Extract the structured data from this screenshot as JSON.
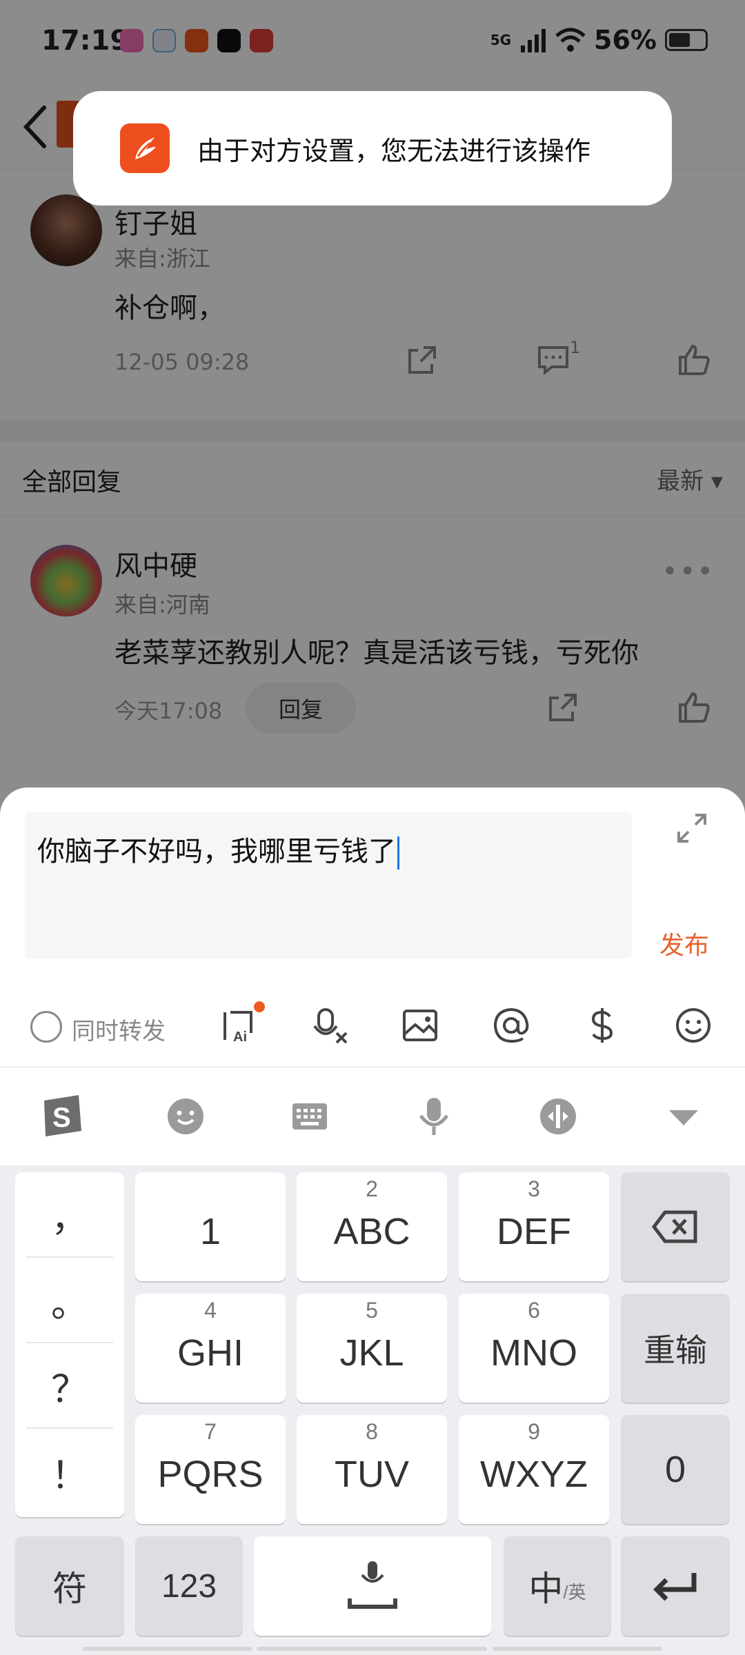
{
  "status_bar": {
    "time": "17:19",
    "network": "5G",
    "battery": "56%"
  },
  "toast": {
    "message": "由于对方设置，您无法进行该操作"
  },
  "top_comment": {
    "author": "钉子姐",
    "location": "来自:浙江",
    "text": "补仓啊，",
    "time": "12-05 09:28",
    "reply_count": "1"
  },
  "replies_header": {
    "title": "全部回复",
    "sort": "最新 ▾"
  },
  "reply": {
    "author": "风中硬",
    "location": "来自:河南",
    "text": "老菜莩还教别人呢？真是活该亏钱，亏死你",
    "time": "今天17:08",
    "reply_button": "回复"
  },
  "composer": {
    "input_value": "你脑子不好吗，我哪里亏钱了",
    "publish_label": "发布",
    "repost_label": "同时转发"
  },
  "keyboard": {
    "punctuation": [
      "，",
      "。",
      "？",
      "！"
    ],
    "keys": [
      {
        "num": "",
        "label": "1"
      },
      {
        "num": "2",
        "label": "ABC"
      },
      {
        "num": "3",
        "label": "DEF"
      },
      {
        "num": "4",
        "label": "GHI"
      },
      {
        "num": "5",
        "label": "JKL"
      },
      {
        "num": "6",
        "label": "MNO"
      },
      {
        "num": "7",
        "label": "PQRS"
      },
      {
        "num": "8",
        "label": "TUV"
      },
      {
        "num": "9",
        "label": "WXYZ"
      }
    ],
    "reset_label": "重输",
    "zero_label": "0",
    "symbols_label": "符",
    "numbers_label": "123",
    "lang_main": "中",
    "lang_sub": "/英"
  }
}
